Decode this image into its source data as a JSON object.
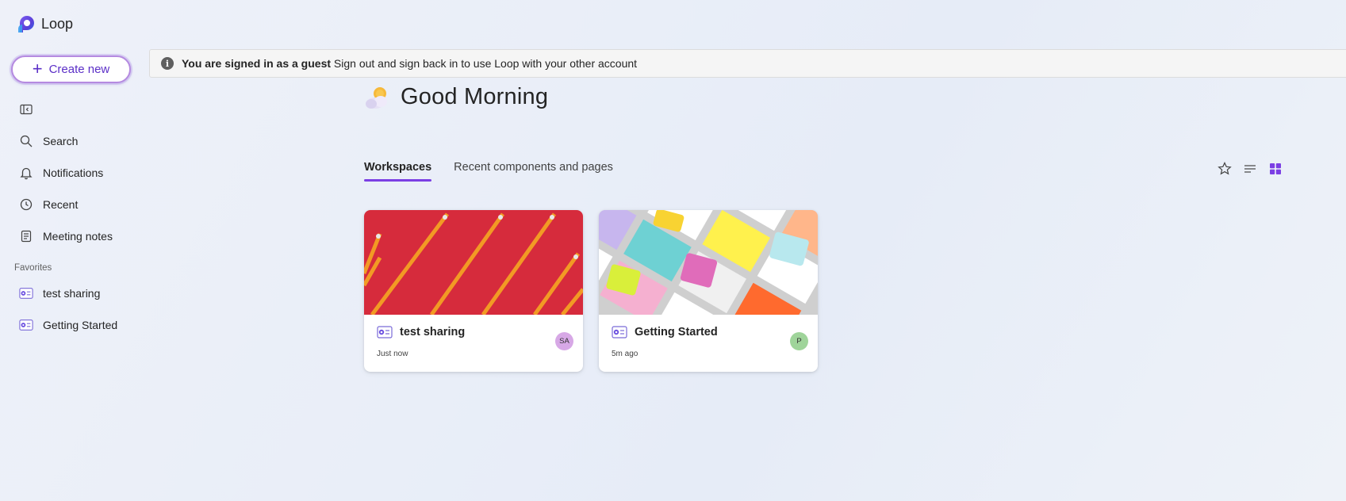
{
  "app": {
    "name": "Loop"
  },
  "sidebar": {
    "create_label": "Create new",
    "items": [
      {
        "label": "Search",
        "icon": "search-icon"
      },
      {
        "label": "Notifications",
        "icon": "bell-icon"
      },
      {
        "label": "Recent",
        "icon": "clock-icon"
      },
      {
        "label": "Meeting notes",
        "icon": "notes-icon"
      }
    ],
    "favorites_header": "Favorites",
    "favorites": [
      {
        "label": "test sharing"
      },
      {
        "label": "Getting Started"
      }
    ]
  },
  "banner": {
    "bold": "You are signed in as a guest",
    "text": "Sign out and sign back in to use Loop with your other account"
  },
  "greeting": {
    "title": "Good Morning"
  },
  "tabs": [
    {
      "label": "Workspaces",
      "active": true
    },
    {
      "label": "Recent components and pages",
      "active": false
    }
  ],
  "cards": [
    {
      "title": "test sharing",
      "time": "Just now",
      "avatar": "SA",
      "avatar_color": "#d7a8e6"
    },
    {
      "title": "Getting Started",
      "time": "5m ago",
      "avatar": "P",
      "avatar_color": "#9fd49a"
    }
  ],
  "colors": {
    "accent": "#7b3fe4",
    "create_text": "#5b2fc7"
  }
}
